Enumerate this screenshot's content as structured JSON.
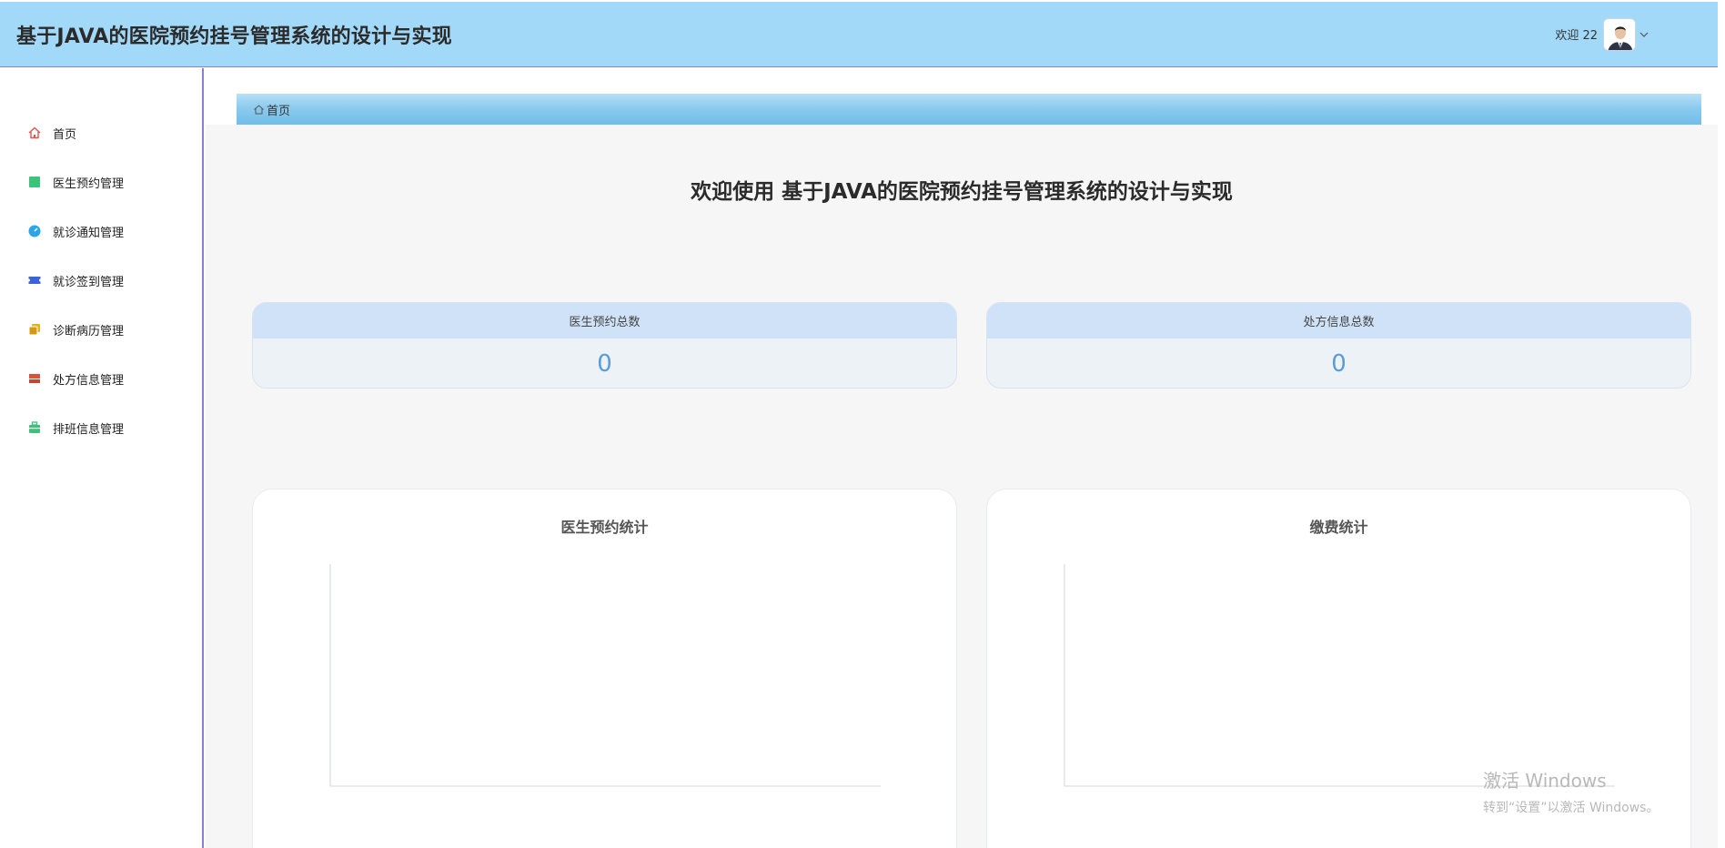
{
  "header": {
    "title": "基于JAVA的医院预约挂号管理系统的设计与实现",
    "welcome_text": "欢迎 22",
    "avatar_icon": "user-avatar",
    "caret_icon": "chevron-down-icon"
  },
  "sidebar": {
    "items": [
      {
        "label": "首页",
        "icon": "home-icon",
        "color": "#e0554f"
      },
      {
        "label": "医生预约管理",
        "icon": "square-icon",
        "color": "#3ec47a"
      },
      {
        "label": "就诊通知管理",
        "icon": "clock-icon",
        "color": "#2da6e8"
      },
      {
        "label": "就诊签到管理",
        "icon": "ticket-icon",
        "color": "#3a64d8"
      },
      {
        "label": "诊断病历管理",
        "icon": "copy-icon",
        "color": "#e5b21f"
      },
      {
        "label": "处方信息管理",
        "icon": "layers-icon",
        "color": "#d9533c"
      },
      {
        "label": "排班信息管理",
        "icon": "briefcase-icon",
        "color": "#3cc377"
      }
    ]
  },
  "breadcrumb": {
    "home_icon": "home-icon",
    "label": "首页"
  },
  "main": {
    "welcome_title": "欢迎使用 基于JAVA的医院预约挂号管理系统的设计与实现",
    "stats": [
      {
        "label": "医生预约总数",
        "value": "0"
      },
      {
        "label": "处方信息总数",
        "value": "0"
      }
    ],
    "charts": [
      {
        "title": "医生预约统计"
      },
      {
        "title": "缴费统计"
      }
    ]
  },
  "watermark": {
    "line1": "激活 Windows",
    "line2": "转到“设置”以激活 Windows。"
  },
  "colors": {
    "header_bg": "#a3d9f8",
    "accent_border": "#8a7fd3",
    "stat_value": "#5b9bd9"
  }
}
